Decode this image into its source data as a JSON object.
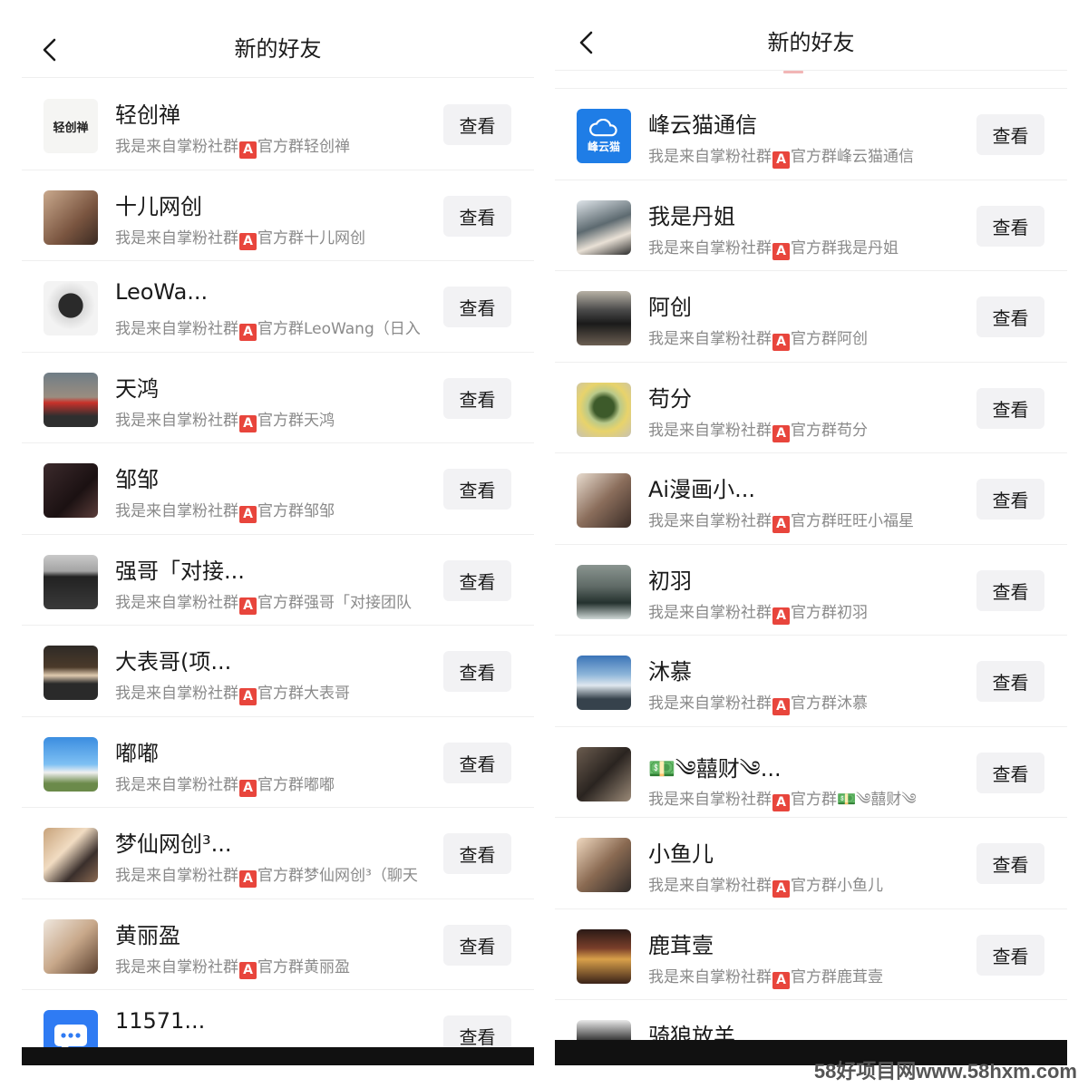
{
  "left": {
    "title": "新的好友",
    "button_label": "查看",
    "contacts": [
      {
        "name": "轻创禅",
        "desc_prefix": "我是来自掌粉社群",
        "desc_badge": "A",
        "desc_suffix": "官方群轻创禅",
        "avatar": "qcc-logo",
        "avatar_text": "轻创禅"
      },
      {
        "name": "十儿网创",
        "desc_prefix": "我是来自掌粉社群",
        "desc_badge": "A",
        "desc_suffix": "官方群十儿网创",
        "avatar": "photo"
      },
      {
        "name": "LeoWa...",
        "desc_prefix": "我是来自掌粉社群",
        "desc_badge": "A",
        "desc_suffix": "官方群LeoWang（日入",
        "avatar": "photo"
      },
      {
        "name": "天鸿",
        "desc_prefix": "我是来自掌粉社群",
        "desc_badge": "A",
        "desc_suffix": "官方群天鸿",
        "avatar": "photo"
      },
      {
        "name": "邹邹",
        "desc_prefix": "我是来自掌粉社群",
        "desc_badge": "A",
        "desc_suffix": "官方群邹邹",
        "avatar": "photo"
      },
      {
        "name": "强哥「对接...",
        "desc_prefix": "我是来自掌粉社群",
        "desc_badge": "A",
        "desc_suffix": "官方群强哥「对接团队",
        "avatar": "photo"
      },
      {
        "name": "大表哥(项...",
        "desc_prefix": "我是来自掌粉社群",
        "desc_badge": "A",
        "desc_suffix": "官方群大表哥",
        "avatar": "photo"
      },
      {
        "name": "嘟嘟",
        "desc_prefix": "我是来自掌粉社群",
        "desc_badge": "A",
        "desc_suffix": "官方群嘟嘟",
        "avatar": "photo"
      },
      {
        "name": "梦仙网创³...",
        "desc_prefix": "我是来自掌粉社群",
        "desc_badge": "A",
        "desc_suffix": "官方群梦仙网创³（聊天",
        "avatar": "photo"
      },
      {
        "name": "黄丽盈",
        "desc_prefix": "我是来自掌粉社群",
        "desc_badge": "A",
        "desc_suffix": "官方群黄丽盈",
        "avatar": "photo"
      },
      {
        "name": "11571...",
        "desc_prefix": "",
        "desc_badge": "",
        "desc_suffix": "",
        "avatar": "chat-icon"
      }
    ]
  },
  "right": {
    "title": "新的好友",
    "button_label": "查看",
    "contacts": [
      {
        "name": "峰云猫通信",
        "desc_prefix": "我是来自掌粉社群",
        "desc_badge": "A",
        "desc_suffix": "官方群峰云猫通信",
        "avatar": "fyun-logo",
        "avatar_text": "峰云猫"
      },
      {
        "name": "我是丹姐",
        "desc_prefix": "我是来自掌粉社群",
        "desc_badge": "A",
        "desc_suffix": "官方群我是丹姐",
        "avatar": "photo"
      },
      {
        "name": "阿创",
        "desc_prefix": "我是来自掌粉社群",
        "desc_badge": "A",
        "desc_suffix": "官方群阿创",
        "avatar": "photo"
      },
      {
        "name": "苟分",
        "desc_prefix": "我是来自掌粉社群",
        "desc_badge": "A",
        "desc_suffix": "官方群苟分",
        "avatar": "photo"
      },
      {
        "name": "Ai漫画小...",
        "desc_prefix": "我是来自掌粉社群",
        "desc_badge": "A",
        "desc_suffix": "官方群旺旺小福星",
        "avatar": "photo"
      },
      {
        "name": "初羽",
        "desc_prefix": "我是来自掌粉社群",
        "desc_badge": "A",
        "desc_suffix": "官方群初羽",
        "avatar": "photo"
      },
      {
        "name": "沐慕",
        "desc_prefix": "我是来自掌粉社群",
        "desc_badge": "A",
        "desc_suffix": "官方群沐慕",
        "avatar": "photo"
      },
      {
        "name": "💵༄囍财༄...",
        "desc_prefix": "我是来自掌粉社群",
        "desc_badge": "A",
        "desc_suffix": "官方群💵༄囍财༄",
        "avatar": "photo"
      },
      {
        "name": "小鱼儿",
        "desc_prefix": "我是来自掌粉社群",
        "desc_badge": "A",
        "desc_suffix": "官方群小鱼儿",
        "avatar": "photo"
      },
      {
        "name": "鹿茸壹",
        "desc_prefix": "我是来自掌粉社群",
        "desc_badge": "A",
        "desc_suffix": "官方群鹿茸壹",
        "avatar": "photo"
      },
      {
        "name": "骑狼放羊",
        "desc_prefix": "",
        "desc_badge": "",
        "desc_suffix": "",
        "avatar": "photo"
      }
    ]
  },
  "watermark": "58好项目网www.58hxm.com"
}
